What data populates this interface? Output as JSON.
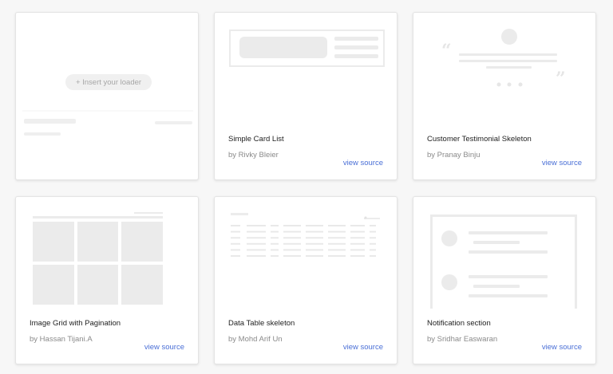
{
  "insert_loader": {
    "label": "+ Insert your loader"
  },
  "cards": [
    {
      "title": "Simple Card List",
      "author": "by Rivky Bleier",
      "link": "view source"
    },
    {
      "title": "Customer Testimonial Skeleton",
      "author": "by Pranay Binju",
      "link": "view source"
    },
    {
      "title": "Image Grid with Pagination",
      "author": "by Hassan Tijani.A",
      "link": "view source"
    },
    {
      "title": "Data Table skeleton",
      "author": "by Mohd Arif Un",
      "link": "view source"
    },
    {
      "title": "Notification section",
      "author": "by Sridhar Easwaran",
      "link": "view source"
    }
  ],
  "colors": {
    "link": "#4a6fd6",
    "skeleton": "#ededed",
    "background": "#f7f7f7"
  }
}
